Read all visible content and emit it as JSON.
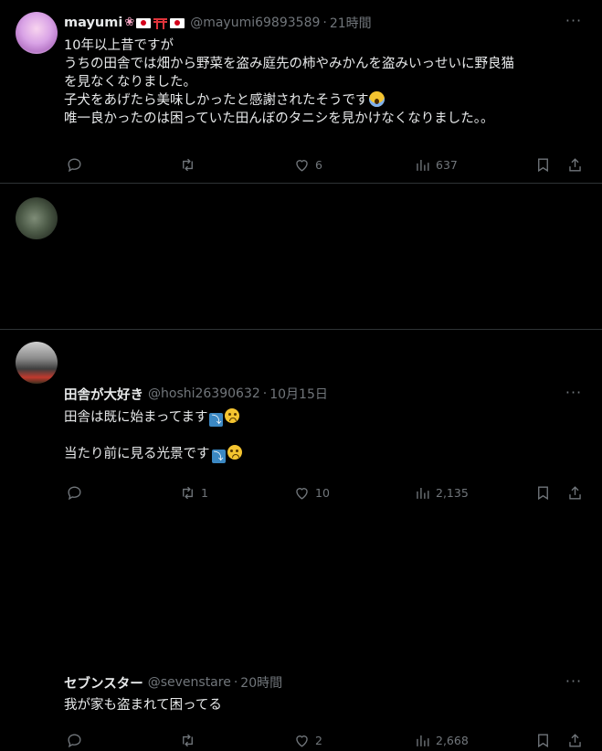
{
  "tweets": [
    {
      "display_name": "mayumi",
      "handle": "@mayumi69893589",
      "separator": "·",
      "time": "21時間",
      "body_lines": [
        "10年以上昔ですが",
        "うちの田舎では畑から野菜を盗み庭先の柿やみかんを盗みいっせいに野良猫",
        "を見なくなりました。",
        "子犬をあげたら美味しかったと感謝されたそうです",
        "唯一良かったのは困っていた田んぼのタニシを見かけなくなりました。。"
      ],
      "replies": "",
      "retweets": "",
      "likes": "6",
      "views": "637"
    },
    {
      "display_name": "田舎が大好き",
      "handle": "@hoshi26390632",
      "separator": "·",
      "time": "10月15日",
      "body_lines": [
        "田舎は既に始まってます",
        "当たり前に見る光景です"
      ],
      "replies": "",
      "retweets": "1",
      "likes": "10",
      "views": "2,135"
    },
    {
      "display_name": "セブンスター",
      "handle": "@sevenstare",
      "separator": "·",
      "time": "20時間",
      "body_lines": [
        "我が家も盗まれて困ってる"
      ],
      "replies": "",
      "retweets": "",
      "likes": "2",
      "views": "2,668"
    }
  ],
  "more_label": "···",
  "icons": {
    "reply": "reply-icon",
    "retweet": "retweet-icon",
    "like": "heart-icon",
    "views": "views-icon",
    "bookmark": "bookmark-icon",
    "share": "share-icon"
  },
  "colors": {
    "background": "#000000",
    "text": "#e7e9ea",
    "muted": "#71767b",
    "divider": "#2f3336"
  }
}
